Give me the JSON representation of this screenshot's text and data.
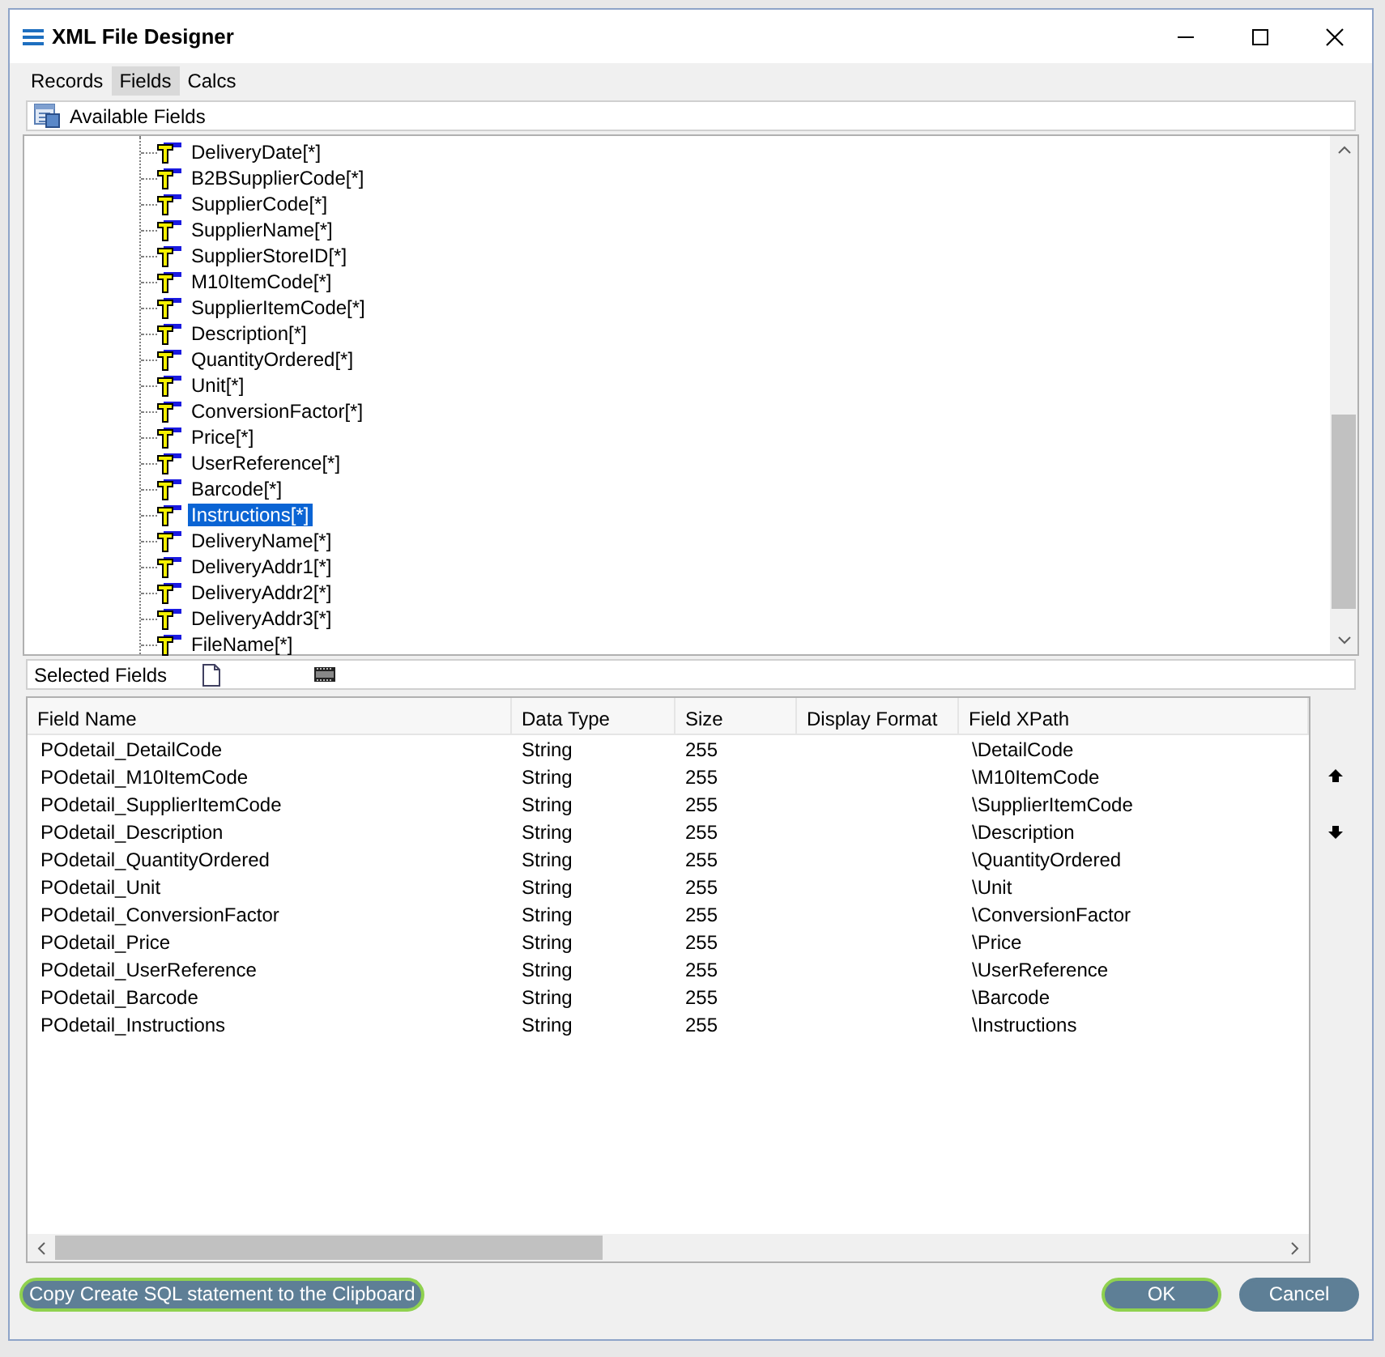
{
  "window": {
    "title": "XML File Designer"
  },
  "tabs": [
    {
      "label": "Records",
      "selected": false
    },
    {
      "label": "Fields",
      "selected": true
    },
    {
      "label": "Calcs",
      "selected": false
    }
  ],
  "available_fields": {
    "title": "Available Fields",
    "items": [
      {
        "label": "DeliveryDate[*]",
        "selected": false
      },
      {
        "label": "B2BSupplierCode[*]",
        "selected": false
      },
      {
        "label": "SupplierCode[*]",
        "selected": false
      },
      {
        "label": "SupplierName[*]",
        "selected": false
      },
      {
        "label": "SupplierStoreID[*]",
        "selected": false
      },
      {
        "label": "M10ItemCode[*]",
        "selected": false
      },
      {
        "label": "SupplierItemCode[*]",
        "selected": false
      },
      {
        "label": "Description[*]",
        "selected": false
      },
      {
        "label": "QuantityOrdered[*]",
        "selected": false
      },
      {
        "label": "Unit[*]",
        "selected": false
      },
      {
        "label": "ConversionFactor[*]",
        "selected": false
      },
      {
        "label": "Price[*]",
        "selected": false
      },
      {
        "label": "UserReference[*]",
        "selected": false
      },
      {
        "label": "Barcode[*]",
        "selected": false
      },
      {
        "label": "Instructions[*]",
        "selected": true
      },
      {
        "label": "DeliveryName[*]",
        "selected": false
      },
      {
        "label": "DeliveryAddr1[*]",
        "selected": false
      },
      {
        "label": "DeliveryAddr2[*]",
        "selected": false
      },
      {
        "label": "DeliveryAddr3[*]",
        "selected": false
      },
      {
        "label": "FileName[*]",
        "selected": false
      }
    ]
  },
  "selected_fields": {
    "title": "Selected Fields",
    "columns": [
      "Field Name",
      "Data Type",
      "Size",
      "Display Format",
      "Field XPath"
    ],
    "rows": [
      [
        "POdetail_DetailCode",
        "String",
        "255",
        "",
        "\\DetailCode"
      ],
      [
        "POdetail_M10ItemCode",
        "String",
        "255",
        "",
        "\\M10ItemCode"
      ],
      [
        "POdetail_SupplierItemCode",
        "String",
        "255",
        "",
        "\\SupplierItemCode"
      ],
      [
        "POdetail_Description",
        "String",
        "255",
        "",
        "\\Description"
      ],
      [
        "POdetail_QuantityOrdered",
        "String",
        "255",
        "",
        "\\QuantityOrdered"
      ],
      [
        "POdetail_Unit",
        "String",
        "255",
        "",
        "\\Unit"
      ],
      [
        "POdetail_ConversionFactor",
        "String",
        "255",
        "",
        "\\ConversionFactor"
      ],
      [
        "POdetail_Price",
        "String",
        "255",
        "",
        "\\Price"
      ],
      [
        "POdetail_UserReference",
        "String",
        "255",
        "",
        "\\UserReference"
      ],
      [
        "POdetail_Barcode",
        "String",
        "255",
        "",
        "\\Barcode"
      ],
      [
        "POdetail_Instructions",
        "String",
        "255",
        "",
        "\\Instructions"
      ]
    ]
  },
  "buttons": [
    {
      "label": "Copy Create SQL statement to the Clipboard",
      "highlighted": true,
      "kind": "left"
    },
    {
      "label": "OK",
      "highlighted": true,
      "kind": "right"
    },
    {
      "label": "Cancel",
      "highlighted": false,
      "kind": "right"
    }
  ]
}
